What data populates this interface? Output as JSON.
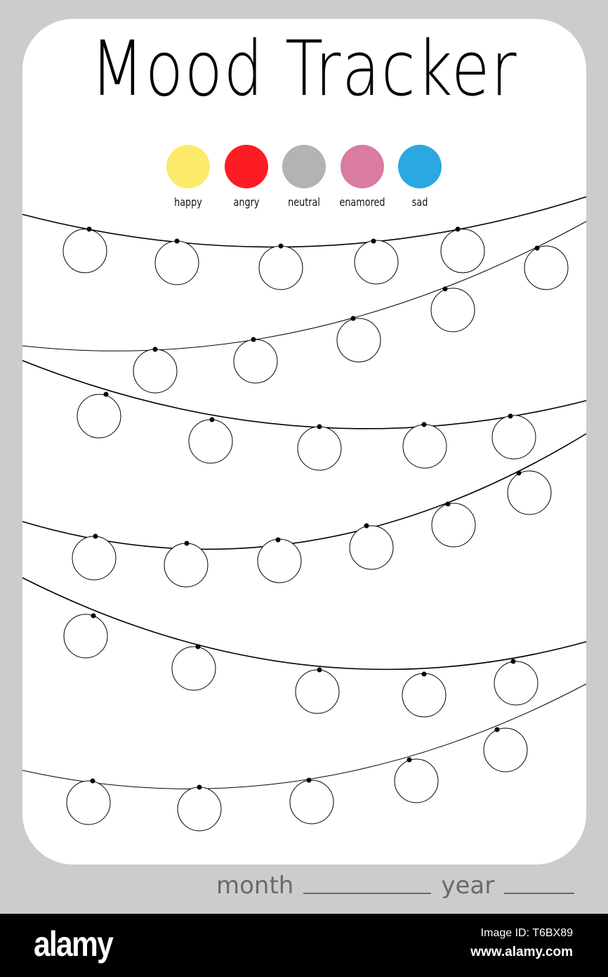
{
  "title": "Mood Tracker",
  "legend": [
    {
      "label": "happy",
      "color": "#fde96a"
    },
    {
      "label": "angry",
      "color": "#fe1c24"
    },
    {
      "label": "neutral",
      "color": "#b3b3b3"
    },
    {
      "label": "enamored",
      "color": "#da7ba1"
    },
    {
      "label": "sad",
      "color": "#2aa8e2"
    }
  ],
  "day_circle_count": 31,
  "footer": {
    "month_label": "month",
    "year_label": "year"
  },
  "watermark": {
    "logo": "alamy",
    "image_id": "Image ID: T6BX89",
    "url": "www.alamy.com"
  }
}
